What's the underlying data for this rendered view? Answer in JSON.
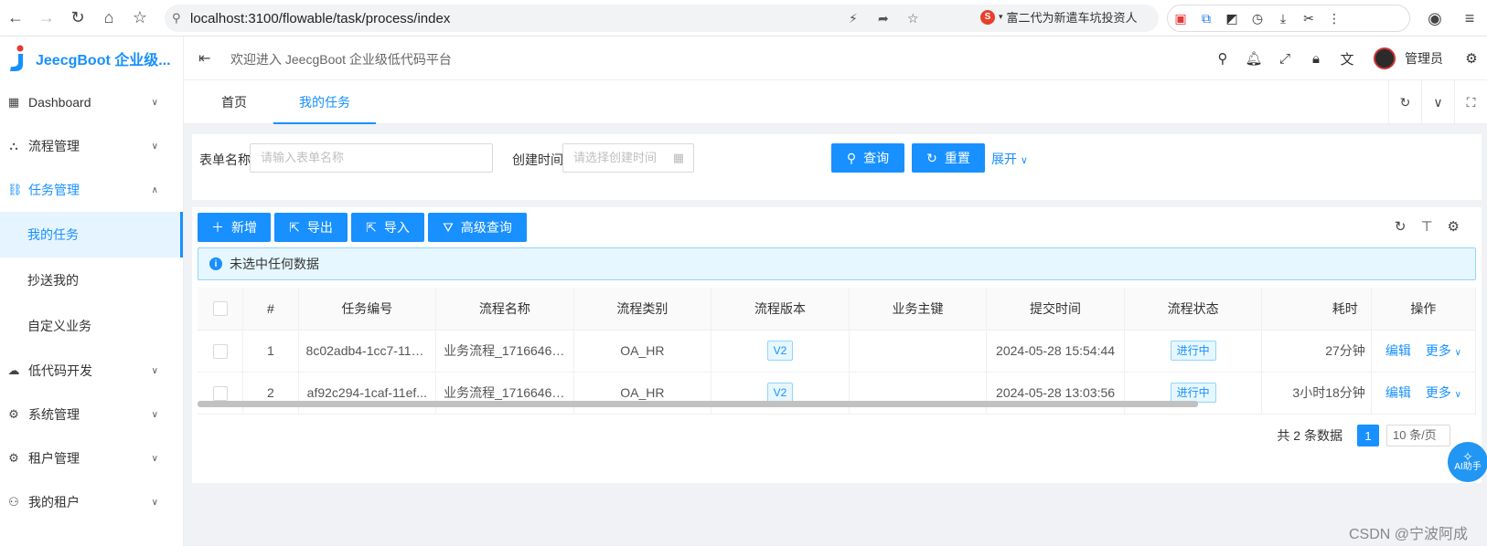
{
  "browser": {
    "url": "localhost:3100/flowable/task/process/index",
    "news": "富二代为新遣车坑投资人"
  },
  "sidebar": {
    "app_title": "JeecgBoot 企业级...",
    "items": [
      {
        "label": "Dashboard",
        "icon": "dashboard-icon"
      },
      {
        "label": "流程管理",
        "icon": "flow-icon"
      },
      {
        "label": "任务管理",
        "icon": "task-icon"
      },
      {
        "label": "低代码开发",
        "icon": "cloud-icon"
      },
      {
        "label": "系统管理",
        "icon": "gear-icon"
      },
      {
        "label": "租户管理",
        "icon": "gear-icon"
      },
      {
        "label": "我的租户",
        "icon": "user-icon"
      }
    ],
    "sub_items": [
      "我的任务",
      "抄送我的",
      "自定义业务"
    ]
  },
  "header": {
    "welcome": "欢迎进入 JeecgBoot 企业级低代码平台",
    "username": "管理员"
  },
  "tabs": [
    {
      "label": "首页"
    },
    {
      "label": "我的任务"
    }
  ],
  "search": {
    "form_name_label": "表单名称",
    "form_name_placeholder": "请输入表单名称",
    "create_time_label": "创建时间",
    "create_time_placeholder": "请选择创建时间",
    "query_button": "查询",
    "reset_button": "重置",
    "expand_link": "展开"
  },
  "toolbar": {
    "add": "新增",
    "export": "导出",
    "import": "导入",
    "advanced_query": "高级查询"
  },
  "alert": {
    "text": "未选中任何数据"
  },
  "table": {
    "headers": [
      "#",
      "任务编号",
      "流程名称",
      "流程类别",
      "流程版本",
      "业务主键",
      "提交时间",
      "流程状态",
      "耗时",
      "操作"
    ],
    "rows": [
      {
        "index": "1",
        "task_no": "8c02adb4-1cc7-11e...",
        "process_name": "业务流程_17166466...",
        "category": "OA_HR",
        "version": "V2",
        "biz_key": "",
        "submit_time": "2024-05-28 15:54:44",
        "status": "进行中",
        "duration": "27分钟",
        "edit": "编辑",
        "more": "更多"
      },
      {
        "index": "2",
        "task_no": "af92c294-1caf-11ef...",
        "process_name": "业务流程_17166466...",
        "category": "OA_HR",
        "version": "V2",
        "biz_key": "",
        "submit_time": "2024-05-28 13:03:56",
        "status": "进行中",
        "duration": "3小时18分钟",
        "edit": "编辑",
        "more": "更多"
      }
    ]
  },
  "pagination": {
    "total": "共 2 条数据",
    "current": "1",
    "page_size": "10 条/页"
  },
  "ai_assistant": "AI助手",
  "watermark": "CSDN @宁波阿成",
  "colors": {
    "primary": "#1890ff",
    "background": "#f0f2f5"
  }
}
